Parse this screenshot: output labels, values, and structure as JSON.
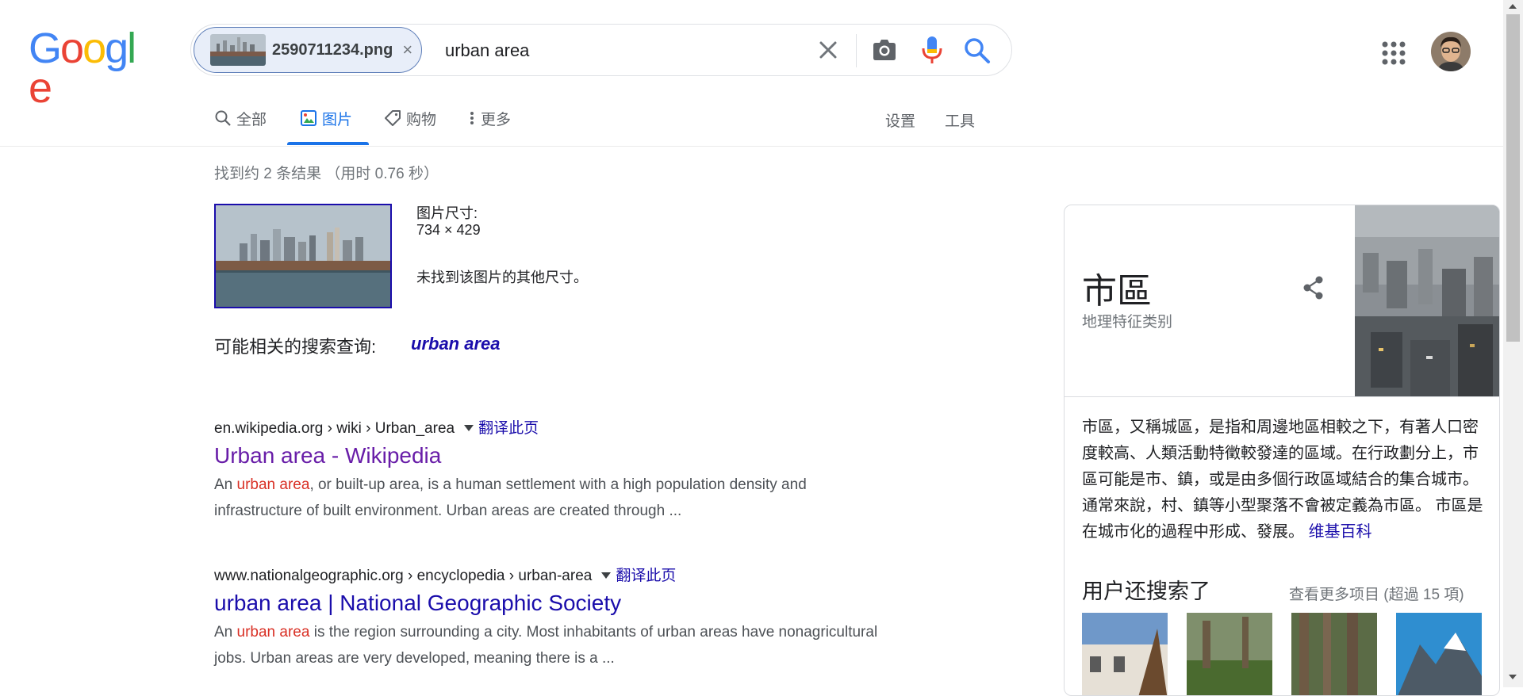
{
  "logo": "Google",
  "search": {
    "image_chip_name": "2590711234.png",
    "chip_close_glyph": "×",
    "query": "urban area"
  },
  "tabs": [
    {
      "label": "全部",
      "icon": "search-icon"
    },
    {
      "label": "图片",
      "icon": "image-icon",
      "active": true
    },
    {
      "label": "购物",
      "icon": "tag-icon"
    },
    {
      "label": "更多",
      "icon": "more-vert-icon"
    }
  ],
  "tools": {
    "settings": "设置",
    "tools": "工具"
  },
  "results_stats": "找到约 2 条结果 （用时 0.76 秒）",
  "image_info": {
    "size_label": "图片尺寸:",
    "size_value": "734 × 429",
    "no_other_sizes": "未找到该图片的其他尺寸。"
  },
  "related": {
    "label": "可能相关的搜索查询:",
    "query": "urban area"
  },
  "results": [
    {
      "url": "en.wikipedia.org › wiki › Urban_area",
      "translate": "翻译此页",
      "title": "Urban area - Wikipedia",
      "title_color": "#681da8",
      "snippet_pre": "An ",
      "snippet_hl": "urban area",
      "snippet_post": ", or built-up area, is a human settlement with a high population density and infrastructure of built environment. Urban areas are created through ..."
    },
    {
      "url": "www.nationalgeographic.org › encyclopedia › urban-area",
      "translate": "翻译此页",
      "title": "urban area | National Geographic Society",
      "title_color": "#1a0dab",
      "snippet_pre": "An ",
      "snippet_hl": "urban area",
      "snippet_post": " is the region surrounding a city. Most inhabitants of urban areas have nonagricultural jobs. Urban areas are very developed, meaning there is a ..."
    }
  ],
  "knowledge_panel": {
    "title": "市區",
    "subtitle": "地理特征类别",
    "description": "市區，又稱城區，是指和周邊地區相較之下，有著人口密度較高、人類活動特徵較發達的區域。在行政劃分上，市區可能是市、鎮，或是由多個行政區域結合的集合城市。通常來說，村、鎮等小型聚落不會被定義為市區。 市區是在城市化的過程中形成、發展。",
    "source": "维基百科",
    "people_also_search": "用户还搜索了",
    "see_more": "查看更多项目 (超過 15 項)"
  },
  "colors": {
    "accent": "#1a73e8",
    "link": "#1a0dab",
    "visited": "#681da8",
    "highlight": "#d93025"
  }
}
